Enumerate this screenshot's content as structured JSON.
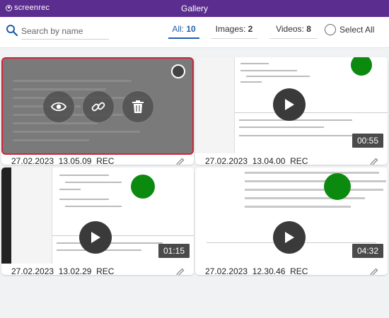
{
  "app": {
    "brand": "screenrec",
    "title": "Gallery"
  },
  "search": {
    "placeholder": "Search by name"
  },
  "filters": {
    "all": {
      "label": "All:",
      "count": "10"
    },
    "images": {
      "label": "Images:",
      "count": "2"
    },
    "videos": {
      "label": "Videos:",
      "count": "8"
    }
  },
  "select_all_label": "Select All",
  "items": [
    {
      "name": "27.02.2023_13.05.09_REC",
      "duration": "",
      "selected": true,
      "actions": [
        "eye-icon",
        "link-icon",
        "trash-icon"
      ]
    },
    {
      "name": "27.02.2023_13.04.00_REC",
      "duration": "00:55",
      "selected": false
    },
    {
      "name": "27.02.2023_13.02.29_REC",
      "duration": "01:15",
      "selected": false
    },
    {
      "name": "27.02.2023_12.30.46_REC",
      "duration": "04:32",
      "selected": false
    }
  ],
  "colors": {
    "brand": "#5b2d8e",
    "accent": "#1f5fa8",
    "selection": "#d0243a"
  }
}
